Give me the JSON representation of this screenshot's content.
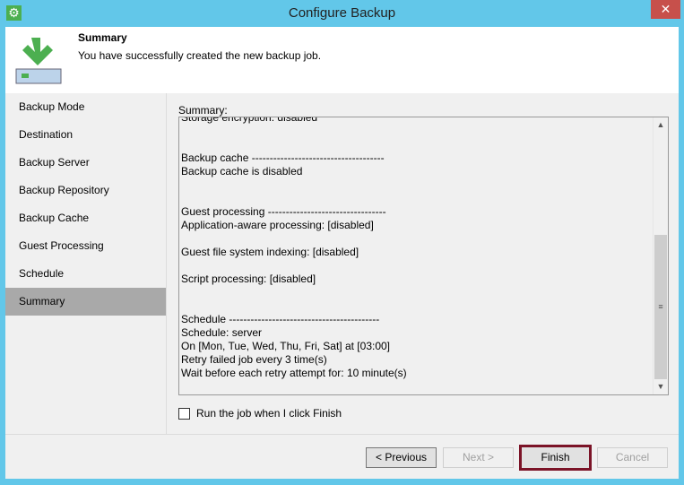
{
  "window": {
    "title": "Configure Backup",
    "close_label": "✕"
  },
  "header": {
    "title": "Summary",
    "subtitle": "You have successfully created the new backup job."
  },
  "nav": {
    "items": [
      {
        "label": "Backup Mode"
      },
      {
        "label": "Destination"
      },
      {
        "label": "Backup Server"
      },
      {
        "label": "Backup Repository"
      },
      {
        "label": "Backup Cache"
      },
      {
        "label": "Guest Processing"
      },
      {
        "label": "Schedule"
      },
      {
        "label": "Summary",
        "selected": true
      }
    ]
  },
  "summary": {
    "label": "Summary:",
    "lines": [
      "Storage encryption: disabled",
      "",
      "",
      "Backup cache -------------------------------------",
      "Backup cache is disabled",
      "",
      "",
      "Guest processing ---------------------------------",
      "Application-aware processing: [disabled]",
      "",
      "Guest file system indexing: [disabled]",
      "",
      "Script processing: [disabled]",
      "",
      "",
      "Schedule ------------------------------------------",
      "Schedule: server",
      "On [Mon, Tue, Wed, Thu, Fri, Sat] at [03:00]",
      "Retry failed job every 3 time(s)",
      "Wait before each retry attempt for: 10 minute(s)"
    ]
  },
  "options": {
    "run_on_finish_label": "Run the job when I click Finish",
    "run_on_finish_checked": false
  },
  "buttons": {
    "previous": "< Previous",
    "next": "Next >",
    "finish": "Finish",
    "cancel": "Cancel"
  },
  "colors": {
    "accent": "#62c7e9",
    "finish_highlight": "#7b1327",
    "icon_green": "#4caf50"
  }
}
